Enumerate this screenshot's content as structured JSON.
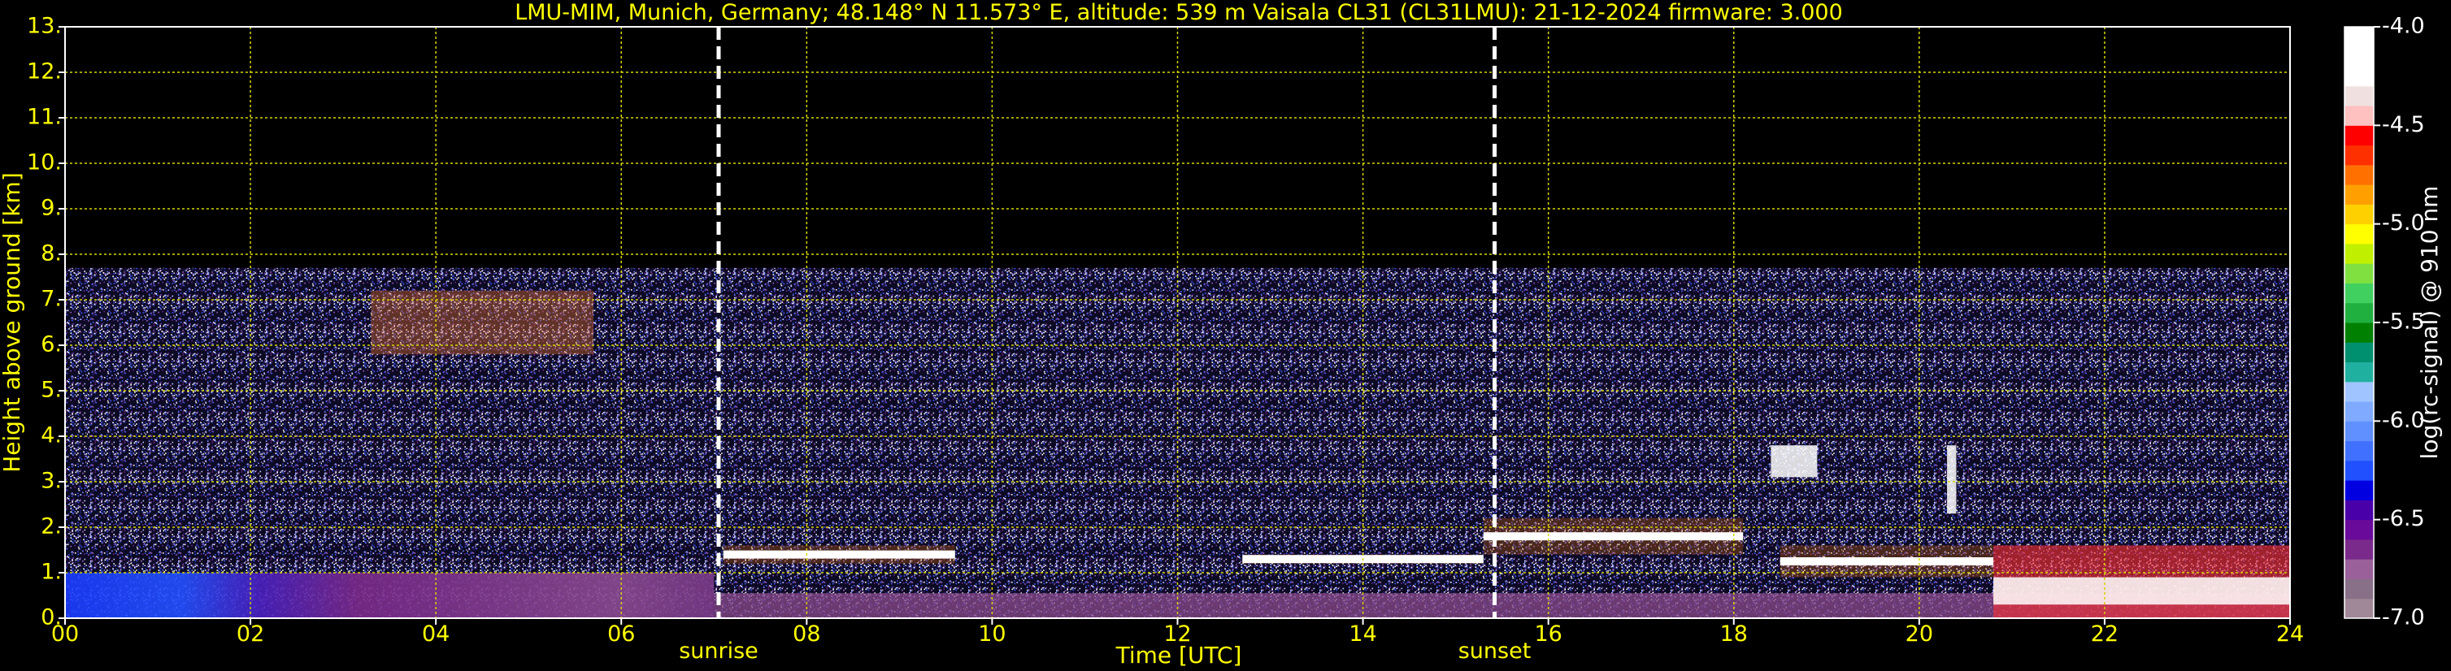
{
  "chart_data": {
    "type": "heatmap",
    "title": "LMU-MIM, Munich, Germany; 48.148° N 11.573° E, altitude: 539 m    Vaisala CL31 (CL31LMU): 21-12-2024    firmware: 3.000",
    "xlabel": "Time [UTC]",
    "ylabel": "Height above ground [km]",
    "xlim": [
      0,
      24
    ],
    "ylim": [
      0,
      13
    ],
    "x_ticks": [
      "00",
      "02",
      "04",
      "06",
      "08",
      "10",
      "12",
      "14",
      "16",
      "18",
      "20",
      "22",
      "24"
    ],
    "y_ticks": [
      "0.",
      "1.",
      "2.",
      "3.",
      "4.",
      "5.",
      "6.",
      "7.",
      "8.",
      "9.",
      "10.",
      "11.",
      "12.",
      "13."
    ],
    "y_tick_values": [
      0,
      1,
      2,
      3,
      4,
      5,
      6,
      7,
      8,
      9,
      10,
      11,
      12,
      13
    ],
    "grid": true,
    "events": [
      {
        "label": "sunrise",
        "x": 7.05
      },
      {
        "label": "sunset",
        "x": 15.42
      }
    ],
    "colorbar": {
      "label": "log(rc-signal) @ 910 nm",
      "range": [
        -7.0,
        -4.0
      ],
      "ticks": [
        "-4.0",
        "-4.5",
        "-5.0",
        "-5.5",
        "-6.0",
        "-6.5",
        "-7.0"
      ],
      "tick_values": [
        -4.0,
        -4.5,
        -5.0,
        -5.5,
        -6.0,
        -6.5,
        -7.0
      ],
      "colors": [
        "#a08898",
        "#887088",
        "#9a609a",
        "#7a2a8a",
        "#6a0a9a",
        "#4a00a8",
        "#0000e0",
        "#2050ff",
        "#4070ff",
        "#6090ff",
        "#80aaff",
        "#a0c4ff",
        "#20b0a0",
        "#009070",
        "#008000",
        "#20b040",
        "#40d060",
        "#80e040",
        "#c0f000",
        "#ffff00",
        "#ffd000",
        "#ffa000",
        "#ff7000",
        "#ff3000",
        "#ff0000",
        "#ffc0c0",
        "#f0e0e0",
        "#ffffff",
        "#ffffff",
        "#ffffff"
      ]
    },
    "features": [
      {
        "name": "noise_top_km",
        "value": 7.7
      },
      {
        "name": "boundary_layer_top_km_00_07",
        "value": 1.0
      },
      {
        "name": "cloud_layer",
        "x": [
          7.1,
          9.6
        ],
        "y_km": [
          1.2,
          1.6
        ]
      },
      {
        "name": "cloud_layer",
        "x": [
          12.7,
          15.3
        ],
        "y_km": [
          1.2,
          1.4
        ]
      },
      {
        "name": "cloud_layer",
        "x": [
          15.3,
          18.1
        ],
        "y_km": [
          1.4,
          2.2
        ]
      },
      {
        "name": "cloud_layer",
        "x": [
          18.5,
          20.8
        ],
        "y_km": [
          0.9,
          1.6
        ]
      },
      {
        "name": "strong_return",
        "x": [
          20.8,
          24.0
        ],
        "y_km": [
          0.0,
          1.6
        ]
      },
      {
        "name": "cirrus",
        "x": [
          3.3,
          5.7
        ],
        "y_km": [
          5.8,
          7.2
        ]
      },
      {
        "name": "cloud_patch",
        "x": [
          18.4,
          18.9
        ],
        "y_km": [
          3.1,
          3.8
        ]
      },
      {
        "name": "cloud_patch",
        "x": [
          20.3,
          20.4
        ],
        "y_km": [
          2.3,
          3.8
        ]
      }
    ]
  }
}
